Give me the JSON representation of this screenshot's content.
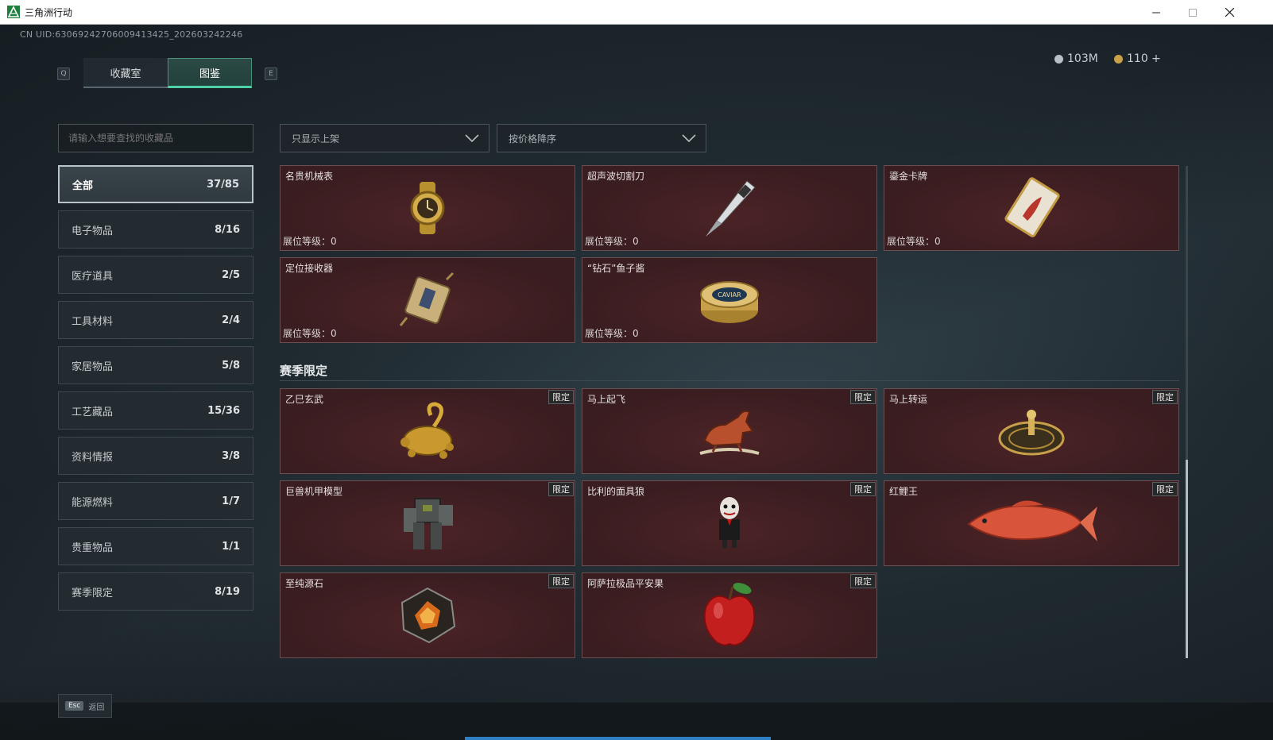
{
  "window": {
    "title": "三角洲行动"
  },
  "uid": "CN UID:6306924270600941342​5_202603242246",
  "currency": [
    {
      "value": "103M",
      "color": "#b7c0c4"
    },
    {
      "value": "110 +",
      "color": "#c8a24a"
    }
  ],
  "hotkeys": {
    "prev": "Q",
    "next": "E"
  },
  "tabs": [
    {
      "label": "收藏室",
      "active": false
    },
    {
      "label": "图鉴",
      "active": true
    }
  ],
  "search": {
    "placeholder": "请输入想要查找的收藏品"
  },
  "filters": {
    "shelf": "只显示上架",
    "sort": "按价格降序"
  },
  "categories": [
    {
      "label": "全部",
      "count": "37/85",
      "active": true
    },
    {
      "label": "电子物品",
      "count": "8/16"
    },
    {
      "label": "医疗道具",
      "count": "2/5"
    },
    {
      "label": "工具材料",
      "count": "2/4"
    },
    {
      "label": "家居物品",
      "count": "5/8"
    },
    {
      "label": "工艺藏品",
      "count": "15/36"
    },
    {
      "label": "资料情报",
      "count": "3/8"
    },
    {
      "label": "能源燃料",
      "count": "1/7"
    },
    {
      "label": "贵重物品",
      "count": "1/1"
    },
    {
      "label": "赛季限定",
      "count": "8/19"
    }
  ],
  "items": [
    {
      "name": "名贵机械表",
      "level": "展位等级：0",
      "icon": "watch-icon"
    },
    {
      "name": "超声波切割刀",
      "level": "展位等级：0",
      "icon": "knife-icon"
    },
    {
      "name": "鎏金卡牌",
      "level": "展位等级：0",
      "icon": "card-icon"
    },
    {
      "name": "定位接收器",
      "level": "展位等级：0",
      "icon": "receiver-icon"
    },
    {
      "name": "“钻石”鱼子酱",
      "level": "展位等级：0",
      "icon": "caviar-icon"
    }
  ],
  "season_section": {
    "title": "赛季限定"
  },
  "season_items": [
    {
      "name": "乙巳玄武",
      "tag": "限定",
      "icon": "turtle-icon"
    },
    {
      "name": "马上起飞",
      "tag": "限定",
      "icon": "horse-icon"
    },
    {
      "name": "马上转运",
      "tag": "限定",
      "icon": "wheel-icon"
    },
    {
      "name": "巨兽机甲模型",
      "tag": "限定",
      "icon": "mech-icon"
    },
    {
      "name": "比利的面具狼",
      "tag": "限定",
      "icon": "puppet-icon"
    },
    {
      "name": "红鲤王",
      "tag": "限定",
      "icon": "carp-icon"
    },
    {
      "name": "至纯源石",
      "tag": "限定",
      "icon": "stone-icon"
    },
    {
      "name": "阿萨拉极品平安果",
      "tag": "限定",
      "icon": "apple-icon"
    }
  ],
  "footer": {
    "esc_key": "Esc",
    "back_label": "返回"
  }
}
